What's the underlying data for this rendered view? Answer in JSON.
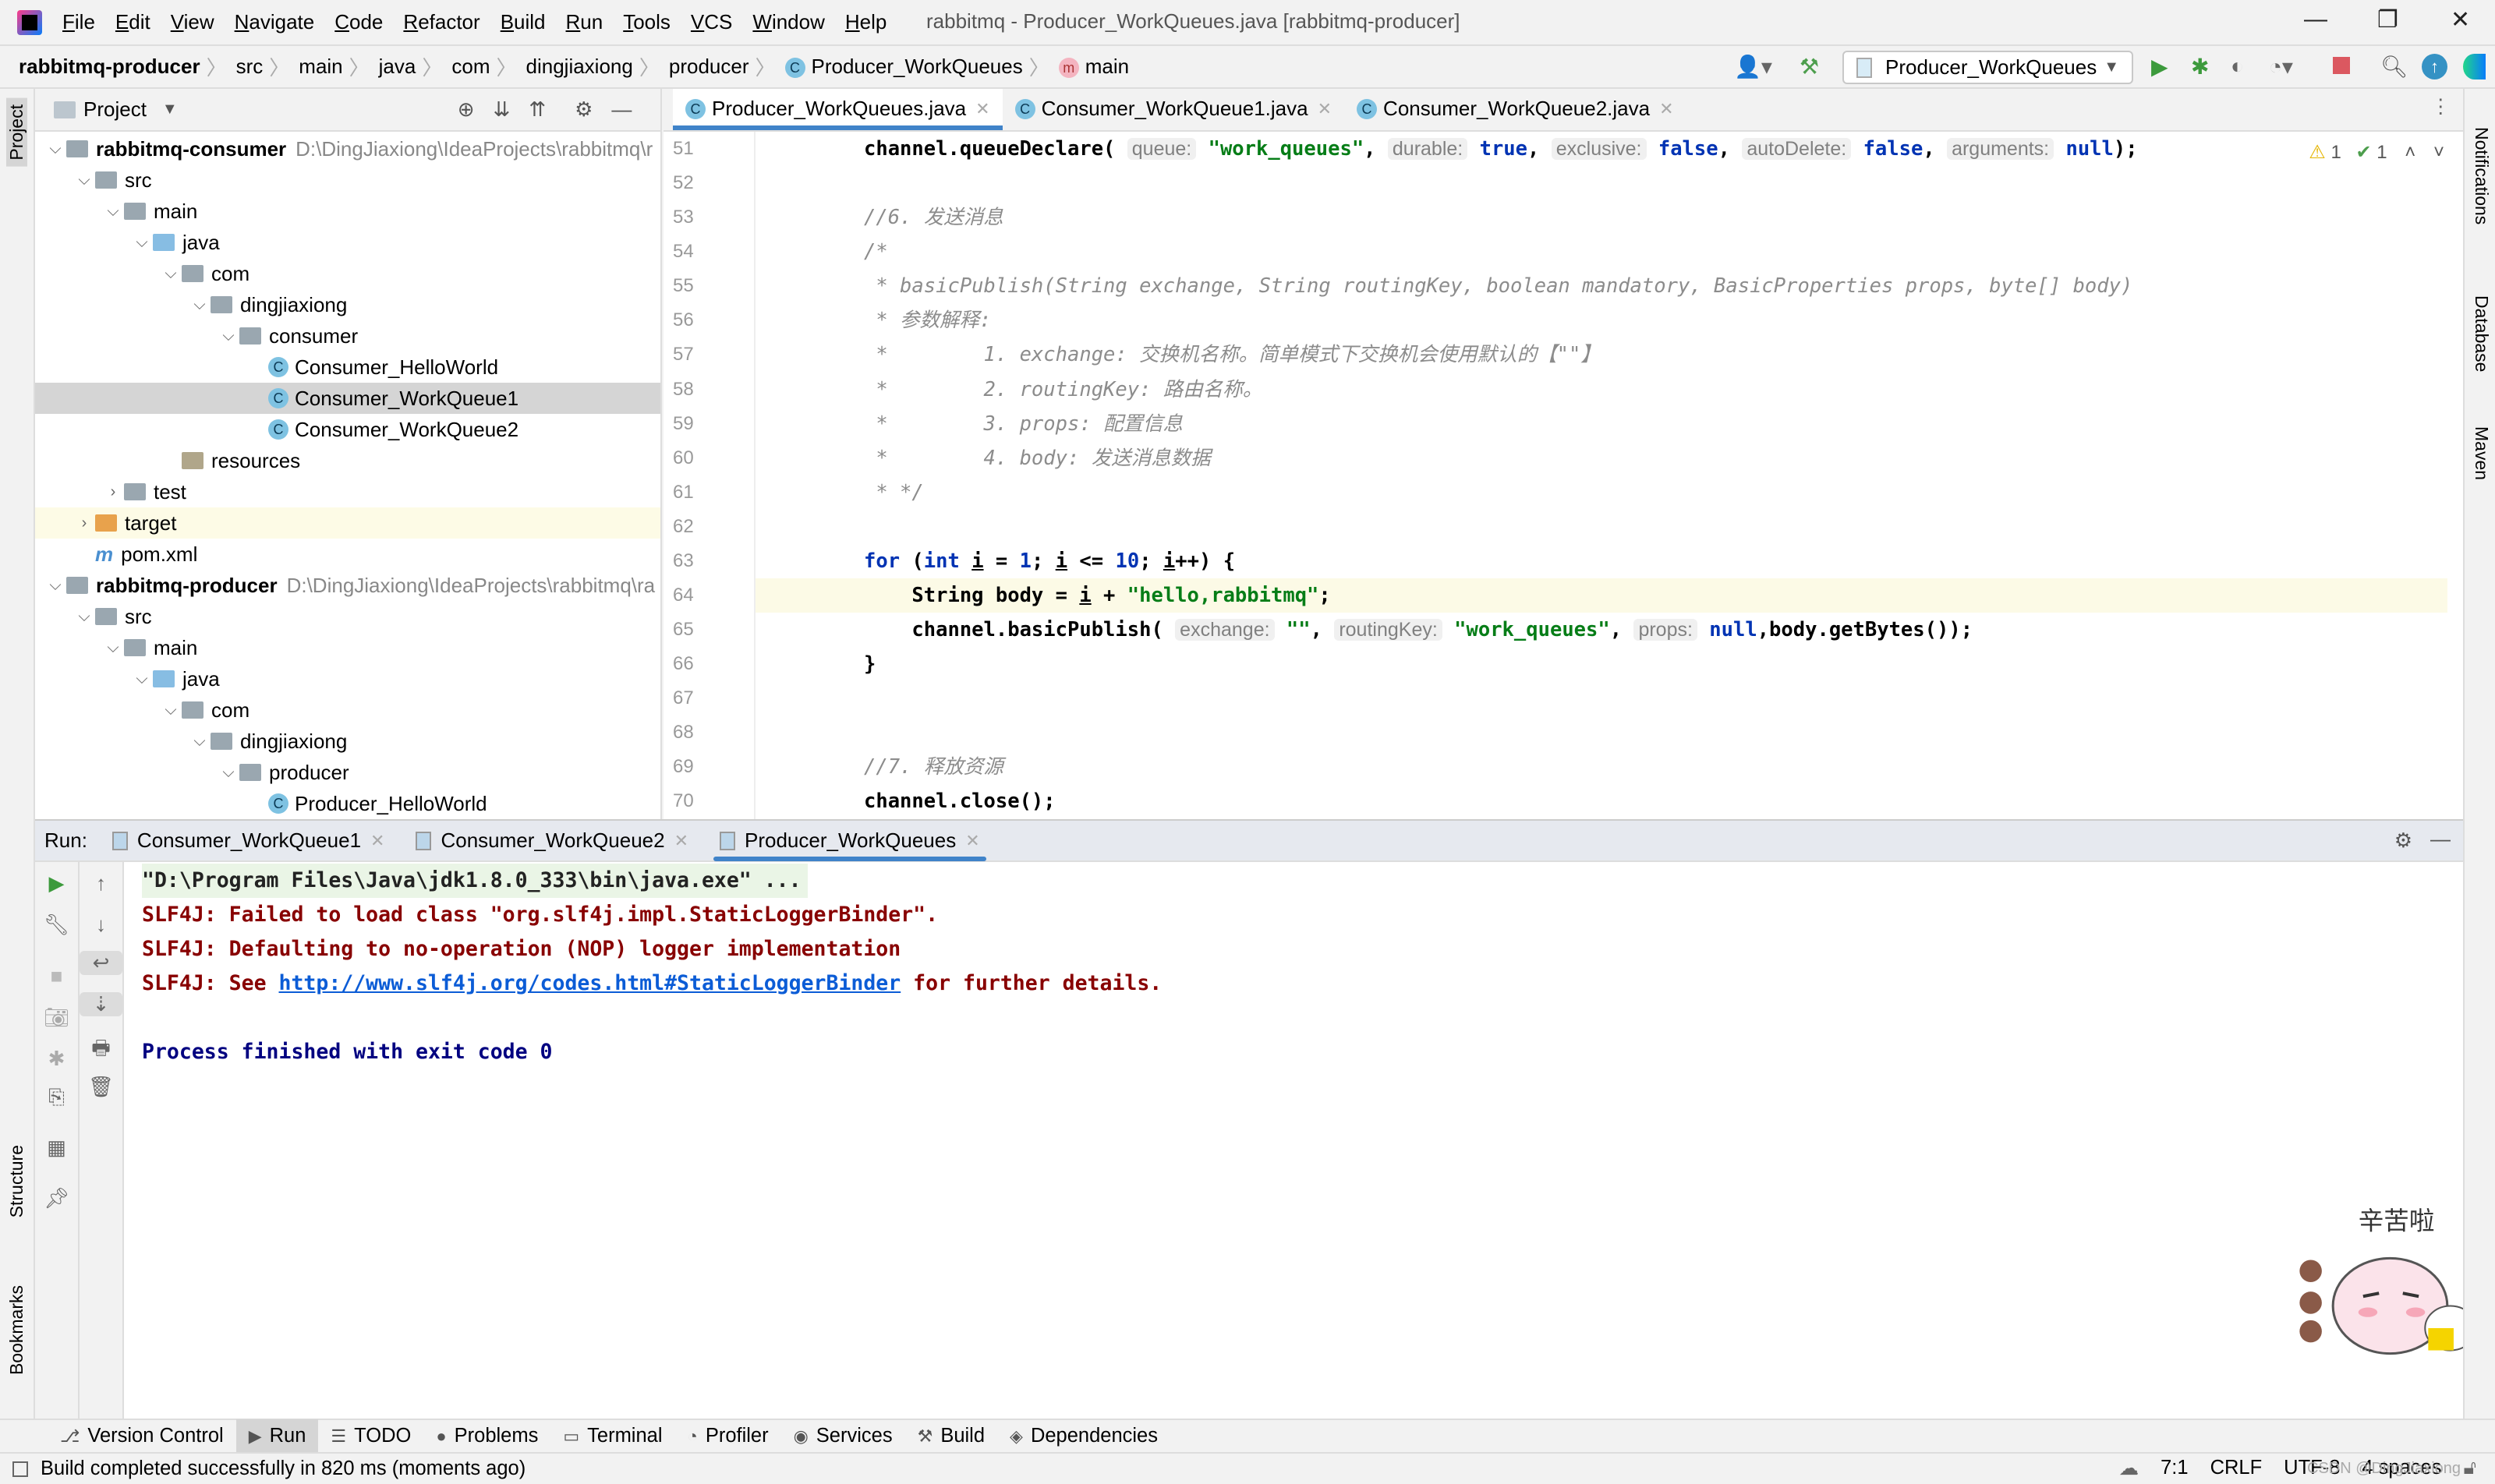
{
  "window": {
    "title": "rabbitmq - Producer_WorkQueues.java [rabbitmq-producer]"
  },
  "menu": [
    "File",
    "Edit",
    "View",
    "Navigate",
    "Code",
    "Refactor",
    "Build",
    "Run",
    "Tools",
    "VCS",
    "Window",
    "Help"
  ],
  "breadcrumb": [
    "rabbitmq-producer",
    "src",
    "main",
    "java",
    "com",
    "dingjiaxiong",
    "producer",
    "Producer_WorkQueues",
    "main"
  ],
  "toolbar": {
    "run_config": "Producer_WorkQueues"
  },
  "side_left": {
    "project": "Project",
    "structure": "Structure",
    "bookmarks": "Bookmarks"
  },
  "side_right": {
    "notifications": "Notifications",
    "database": "Database",
    "maven": "Maven"
  },
  "project": {
    "title": "Project",
    "tree": [
      {
        "label": "rabbitmq-consumer",
        "path": "D:\\DingJiaxiong\\IdeaProjects\\rabbitmq\\r",
        "depth": 0,
        "arrow": "v",
        "icon": "module",
        "bold": true
      },
      {
        "label": "src",
        "depth": 1,
        "arrow": "v",
        "icon": "folder"
      },
      {
        "label": "main",
        "depth": 2,
        "arrow": "v",
        "icon": "folder"
      },
      {
        "label": "java",
        "depth": 3,
        "arrow": "v",
        "icon": "source-folder"
      },
      {
        "label": "com",
        "depth": 4,
        "arrow": "v",
        "icon": "package"
      },
      {
        "label": "dingjiaxiong",
        "depth": 5,
        "arrow": "v",
        "icon": "package"
      },
      {
        "label": "consumer",
        "depth": 6,
        "arrow": "v",
        "icon": "package"
      },
      {
        "label": "Consumer_HelloWorld",
        "depth": 7,
        "arrow": "",
        "icon": "class"
      },
      {
        "label": "Consumer_WorkQueue1",
        "depth": 7,
        "arrow": "",
        "icon": "class",
        "selected": true
      },
      {
        "label": "Consumer_WorkQueue2",
        "depth": 7,
        "arrow": "",
        "icon": "class"
      },
      {
        "label": "resources",
        "depth": 4,
        "arrow": "",
        "icon": "resources"
      },
      {
        "label": "test",
        "depth": 2,
        "arrow": ">",
        "icon": "folder"
      },
      {
        "label": "target",
        "depth": 1,
        "arrow": ">",
        "icon": "excluded-folder",
        "highlight": true
      },
      {
        "label": "pom.xml",
        "depth": 1,
        "arrow": "",
        "icon": "maven"
      },
      {
        "label": "rabbitmq-producer",
        "path": "D:\\DingJiaxiong\\IdeaProjects\\rabbitmq\\ra",
        "depth": 0,
        "arrow": "v",
        "icon": "module",
        "bold": true
      },
      {
        "label": "src",
        "depth": 1,
        "arrow": "v",
        "icon": "folder"
      },
      {
        "label": "main",
        "depth": 2,
        "arrow": "v",
        "icon": "folder"
      },
      {
        "label": "java",
        "depth": 3,
        "arrow": "v",
        "icon": "source-folder"
      },
      {
        "label": "com",
        "depth": 4,
        "arrow": "v",
        "icon": "package"
      },
      {
        "label": "dingjiaxiong",
        "depth": 5,
        "arrow": "v",
        "icon": "package"
      },
      {
        "label": "producer",
        "depth": 6,
        "arrow": "v",
        "icon": "package"
      },
      {
        "label": "Producer_HelloWorld",
        "depth": 7,
        "arrow": "",
        "icon": "class"
      }
    ]
  },
  "editor": {
    "tabs": [
      {
        "label": "Producer_WorkQueues.java",
        "active": true
      },
      {
        "label": "Consumer_WorkQueue1.java"
      },
      {
        "label": "Consumer_WorkQueue2.java"
      }
    ],
    "inspections": {
      "warnings": "1",
      "weak_warnings": "1"
    },
    "lines": [
      {
        "n": "51",
        "t": [
          [
            "",
            "channel.queueDeclare( "
          ],
          [
            "h",
            "queue:"
          ],
          [
            "s",
            " \"work_queues\""
          ],
          [
            "",
            ", "
          ],
          [
            "h",
            "durable:"
          ],
          [
            "k",
            " true"
          ],
          [
            "",
            ", "
          ],
          [
            "h",
            "exclusive:"
          ],
          [
            "k",
            " false"
          ],
          [
            "",
            ", "
          ],
          [
            "h",
            "autoDelete:"
          ],
          [
            "k",
            " false"
          ],
          [
            "",
            ", "
          ],
          [
            "h",
            "arguments:"
          ],
          [
            "k",
            " null"
          ],
          [
            "",
            ");"
          ]
        ]
      },
      {
        "n": "52",
        "t": []
      },
      {
        "n": "53",
        "t": [
          [
            "c",
            "//6. 发送消息"
          ]
        ]
      },
      {
        "n": "54",
        "t": [
          [
            "c",
            "/*"
          ]
        ]
      },
      {
        "n": "55",
        "t": [
          [
            "c",
            " * basicPublish(String exchange, String routingKey, boolean mandatory, BasicProperties props, byte[] body)"
          ]
        ]
      },
      {
        "n": "56",
        "t": [
          [
            "c",
            " * 参数解释:"
          ]
        ]
      },
      {
        "n": "57",
        "t": [
          [
            "c",
            " *        1. exchange: 交换机名称。简单模式下交换机会使用默认的【\"\"】"
          ]
        ]
      },
      {
        "n": "58",
        "t": [
          [
            "c",
            " *        2. routingKey: 路由名称。"
          ]
        ]
      },
      {
        "n": "59",
        "t": [
          [
            "c",
            " *        3. props: 配置信息"
          ]
        ]
      },
      {
        "n": "60",
        "t": [
          [
            "c",
            " *        4. body: 发送消息数据"
          ]
        ]
      },
      {
        "n": "61",
        "t": [
          [
            "c",
            " * */"
          ]
        ]
      },
      {
        "n": "62",
        "t": []
      },
      {
        "n": "63",
        "t": [
          [
            "k",
            "for "
          ],
          [
            "",
            "("
          ],
          [
            "k",
            "int "
          ],
          [
            "u",
            "i"
          ],
          [
            "",
            " = "
          ],
          [
            "k",
            "1"
          ],
          [
            "",
            "; "
          ],
          [
            "u",
            "i"
          ],
          [
            "",
            " <= "
          ],
          [
            "k",
            "10"
          ],
          [
            "",
            "; "
          ],
          [
            "u",
            "i"
          ],
          [
            "",
            "++) {"
          ]
        ]
      },
      {
        "n": "64",
        "cur": true,
        "t": [
          [
            "",
            "    String body = "
          ],
          [
            "u",
            "i"
          ],
          [
            "",
            " + "
          ],
          [
            "s",
            "\"hello,rabbitmq\""
          ],
          [
            "",
            ";"
          ]
        ]
      },
      {
        "n": "65",
        "t": [
          [
            "",
            "    channel.basicPublish( "
          ],
          [
            "h",
            "exchange:"
          ],
          [
            "s",
            " \"\""
          ],
          [
            "",
            ", "
          ],
          [
            "h",
            "routingKey:"
          ],
          [
            "s",
            " \"work_queues\""
          ],
          [
            "",
            ", "
          ],
          [
            "h",
            "props:"
          ],
          [
            "k",
            " null"
          ],
          [
            "",
            ",body.getBytes());"
          ]
        ]
      },
      {
        "n": "66",
        "t": [
          [
            "",
            "}"
          ]
        ]
      },
      {
        "n": "67",
        "t": []
      },
      {
        "n": "68",
        "t": []
      },
      {
        "n": "69",
        "t": [
          [
            "c",
            "//7. 释放资源"
          ]
        ]
      },
      {
        "n": "70",
        "t": [
          [
            "",
            "channel.close();"
          ]
        ]
      }
    ]
  },
  "run": {
    "label": "Run:",
    "tabs": [
      {
        "label": "Consumer_WorkQueue1"
      },
      {
        "label": "Consumer_WorkQueue2"
      },
      {
        "label": "Producer_WorkQueues",
        "active": true
      }
    ],
    "console": {
      "cmd": "\"D:\\Program Files\\Java\\jdk1.8.0_333\\bin\\java.exe\" ...",
      "err1": "SLF4J: Failed to load class \"org.slf4j.impl.StaticLoggerBinder\".",
      "err2": "SLF4J: Defaulting to no-operation (NOP) logger implementation",
      "err3_pre": "SLF4J: See ",
      "err3_link": "http://www.slf4j.org/codes.html#StaticLoggerBinder",
      "err3_post": " for further details.",
      "finished": "Process finished with exit code 0"
    }
  },
  "bottom_tabs": [
    {
      "label": "Version Control",
      "icon": "⎇"
    },
    {
      "label": "Run",
      "icon": "▶",
      "active": true
    },
    {
      "label": "TODO",
      "icon": "☰"
    },
    {
      "label": "Problems",
      "icon": "●"
    },
    {
      "label": "Terminal",
      "icon": "▭"
    },
    {
      "label": "Profiler",
      "icon": "◔"
    },
    {
      "label": "Services",
      "icon": "◉"
    },
    {
      "label": "Build",
      "icon": "⚒"
    },
    {
      "label": "Dependencies",
      "icon": "◈"
    }
  ],
  "status": {
    "message": "Build completed successfully in 820 ms (moments ago)",
    "position": "7:1",
    "line_ending": "CRLF",
    "encoding": "UTF-8",
    "indent": "4 spaces"
  },
  "sticker": {
    "text": "辛苦啦"
  },
  "watermark": "CSDN @DingJiaxiong"
}
